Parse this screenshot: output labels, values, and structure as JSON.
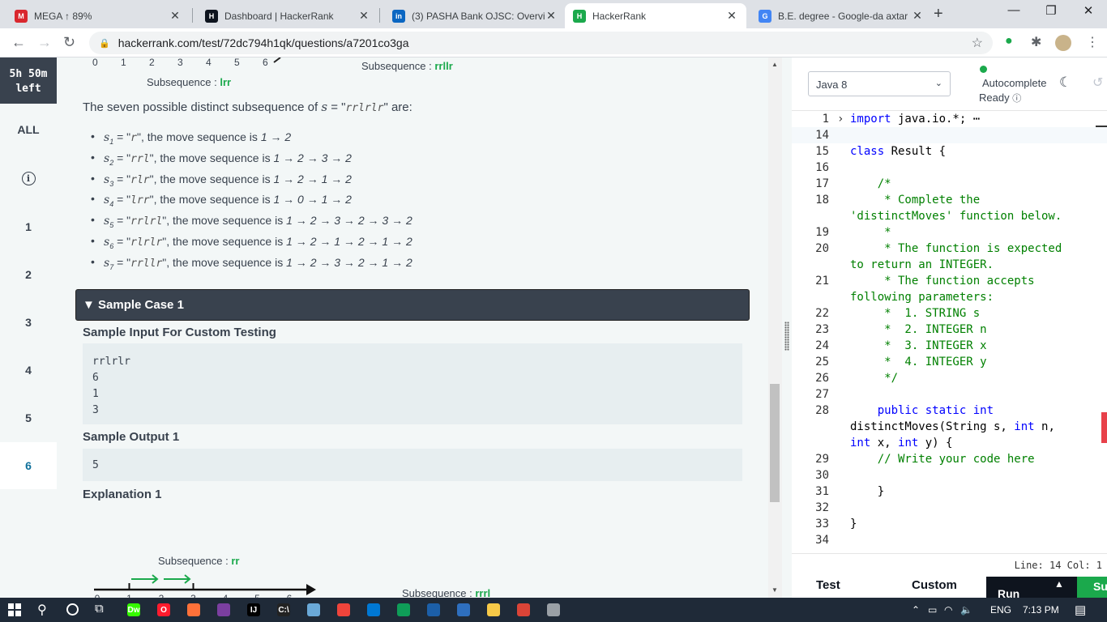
{
  "browser": {
    "tabs": [
      {
        "label": "MEGA ↑ 89%",
        "icon": "mega-icon",
        "color": "#d9272e",
        "fav": "M"
      },
      {
        "label": "Dashboard | HackerRank",
        "icon": "hackerrank-icon",
        "color": "#0e141e",
        "fav": "H"
      },
      {
        "label": "(3) PASHA Bank OJSC: Overvie",
        "icon": "linkedin-icon",
        "color": "#0a66c2",
        "fav": "in"
      },
      {
        "label": "HackerRank",
        "icon": "hackerrank-icon",
        "color": "#1ba94c",
        "fav": "H"
      },
      {
        "label": "B.E. degree - Google-da axtar",
        "icon": "google-icon",
        "color": "#4285f4",
        "fav": "G"
      }
    ],
    "url": "hackerrank.com/test/72dc794h1qk/questions/a7201co3ga",
    "controls": {
      "minimize": "—",
      "restore": "❐",
      "close": "✕",
      "new_tab": "+"
    }
  },
  "sidebar": {
    "timer_line1": "5h 50m",
    "timer_line2": "left",
    "all": "ALL",
    "questions": [
      "1",
      "2",
      "3",
      "4",
      "5",
      "6"
    ],
    "active_question": "6"
  },
  "problem": {
    "top_axis": [
      "0",
      "1",
      "2",
      "3",
      "4",
      "5",
      "6"
    ],
    "top_sub_left": {
      "label": "Subsequence : ",
      "value": "lrr"
    },
    "top_sub_right": {
      "label": "Subsequence : ",
      "value": "rrllr"
    },
    "intro": {
      "before": "The seven possible distinct subsequence of ",
      "var": "s",
      "mid": " = \"",
      "string": "rrlrlr",
      "after": "\" are:"
    },
    "items": [
      {
        "sub": "1",
        "seq": "r",
        "moves": "1 → 2"
      },
      {
        "sub": "2",
        "seq": "rrl",
        "moves": "1 → 2 → 3 → 2"
      },
      {
        "sub": "3",
        "seq": "rlr",
        "moves": "1 → 2 → 1 → 2"
      },
      {
        "sub": "4",
        "seq": "lrr",
        "moves": "1 → 0 → 1 → 2"
      },
      {
        "sub": "5",
        "seq": "rrlrl",
        "moves": "1 → 2 → 3 → 2 → 3 → 2"
      },
      {
        "sub": "6",
        "seq": "rlrlr",
        "moves": "1 → 2 → 1 → 2 → 1 → 2"
      },
      {
        "sub": "7",
        "seq": "rrllr",
        "moves": "1 → 2 → 3 → 2 → 1 → 2"
      }
    ],
    "move_text": "\", the move sequence is ",
    "sample_title": "▼ Sample Case 1",
    "input_heading": "Sample Input For Custom Testing",
    "input_lines": [
      "rrlrlr",
      "6",
      "1",
      "3"
    ],
    "output_heading": "Sample Output 1",
    "output_value": "5",
    "explanation_heading": "Explanation 1",
    "diagram_axis": [
      "0",
      "1",
      "2",
      "3",
      "4",
      "5",
      "6"
    ],
    "diagram1_sub": {
      "label": "Subsequence : ",
      "value": "rr"
    },
    "diagram2_sub": {
      "label": "Subsequence : ",
      "value": "rrrl"
    }
  },
  "editor": {
    "language": "Java 8",
    "autocomplete": "Autocomplete",
    "ready": "Ready",
    "status": "Line: 14 Col: 1",
    "test_tab": "Test",
    "custom_tab": "Custom",
    "run_label": "Run",
    "submit_label": "Su",
    "lines": [
      {
        "n": "1",
        "parts": [
          {
            "t": "import",
            "c": "kw"
          },
          {
            "t": " java.io.*;",
            "c": "id"
          },
          {
            "t": " ⋯",
            "c": "id"
          }
        ]
      },
      {
        "n": "14",
        "parts": []
      },
      {
        "n": "15",
        "parts": [
          {
            "t": "class",
            "c": "kw"
          },
          {
            "t": " Result {",
            "c": "id"
          }
        ]
      },
      {
        "n": "16",
        "parts": []
      },
      {
        "n": "17",
        "parts": [
          {
            "t": "    /*",
            "c": "cm"
          }
        ]
      },
      {
        "n": "18",
        "parts": [
          {
            "t": "     * Complete the",
            "c": "cm"
          }
        ]
      },
      {
        "n": "",
        "parts": [
          {
            "t": "'distinctMoves' function below.",
            "c": "cm"
          }
        ]
      },
      {
        "n": "19",
        "parts": [
          {
            "t": "     *",
            "c": "cm"
          }
        ]
      },
      {
        "n": "20",
        "parts": [
          {
            "t": "     * The function is expected",
            "c": "cm"
          }
        ]
      },
      {
        "n": "",
        "parts": [
          {
            "t": "to return an INTEGER.",
            "c": "cm"
          }
        ]
      },
      {
        "n": "21",
        "parts": [
          {
            "t": "     * The function accepts",
            "c": "cm"
          }
        ]
      },
      {
        "n": "",
        "parts": [
          {
            "t": "following parameters:",
            "c": "cm"
          }
        ]
      },
      {
        "n": "22",
        "parts": [
          {
            "t": "     *  1. STRING s",
            "c": "cm"
          }
        ]
      },
      {
        "n": "23",
        "parts": [
          {
            "t": "     *  2. INTEGER n",
            "c": "cm"
          }
        ]
      },
      {
        "n": "24",
        "parts": [
          {
            "t": "     *  3. INTEGER x",
            "c": "cm"
          }
        ]
      },
      {
        "n": "25",
        "parts": [
          {
            "t": "     *  4. INTEGER y",
            "c": "cm"
          }
        ]
      },
      {
        "n": "26",
        "parts": [
          {
            "t": "     */",
            "c": "cm"
          }
        ]
      },
      {
        "n": "27",
        "parts": []
      },
      {
        "n": "28",
        "parts": [
          {
            "t": "    public static int",
            "c": "kw"
          }
        ]
      },
      {
        "n": "",
        "parts": [
          {
            "t": "distinctMoves(String s, ",
            "c": "id"
          },
          {
            "t": "int",
            "c": "kw"
          },
          {
            "t": " n,",
            "c": "id"
          }
        ]
      },
      {
        "n": "",
        "parts": [
          {
            "t": "int",
            "c": "kw"
          },
          {
            "t": " x, ",
            "c": "id"
          },
          {
            "t": "int",
            "c": "kw"
          },
          {
            "t": " y) {",
            "c": "id"
          }
        ]
      },
      {
        "n": "29",
        "parts": [
          {
            "t": "    // Write your code here",
            "c": "cm"
          }
        ]
      },
      {
        "n": "30",
        "parts": []
      },
      {
        "n": "31",
        "parts": [
          {
            "t": "    }",
            "c": "id"
          }
        ]
      },
      {
        "n": "32",
        "parts": []
      },
      {
        "n": "33",
        "parts": [
          {
            "t": "}",
            "c": "id"
          }
        ]
      },
      {
        "n": "34",
        "parts": []
      }
    ]
  },
  "taskbar": {
    "icons": [
      {
        "name": "dreamweaver-icon",
        "label": "Dw",
        "color": "#35fa00"
      },
      {
        "name": "opera-icon",
        "label": "O",
        "color": "#ff1b2d"
      },
      {
        "name": "firefox-icon",
        "label": "",
        "color": "#ff7139"
      },
      {
        "name": "app-icon",
        "label": "",
        "color": "#7b3fa0"
      },
      {
        "name": "intellij-icon",
        "label": "IJ",
        "color": "#000000"
      },
      {
        "name": "cmd-icon",
        "label": "C:\\",
        "color": "#222222"
      },
      {
        "name": "notepad-icon",
        "label": "",
        "color": "#6aa9d8"
      },
      {
        "name": "anydesk-icon",
        "label": "",
        "color": "#ef443b"
      },
      {
        "name": "vscode-icon",
        "label": "",
        "color": "#0078d4"
      },
      {
        "name": "hangouts-icon",
        "label": "",
        "color": "#0f9d58"
      },
      {
        "name": "wireshark-icon",
        "label": "",
        "color": "#1c5fa8"
      },
      {
        "name": "virtualbox-icon",
        "label": "",
        "color": "#2e6fbf"
      },
      {
        "name": "explorer-icon",
        "label": "",
        "color": "#f7c948"
      },
      {
        "name": "chrome-icon",
        "label": "",
        "color": "#db4437"
      },
      {
        "name": "utility-icon",
        "label": "",
        "color": "#9aa0a6"
      }
    ],
    "language": "ENG",
    "time": "7:13 PM"
  }
}
